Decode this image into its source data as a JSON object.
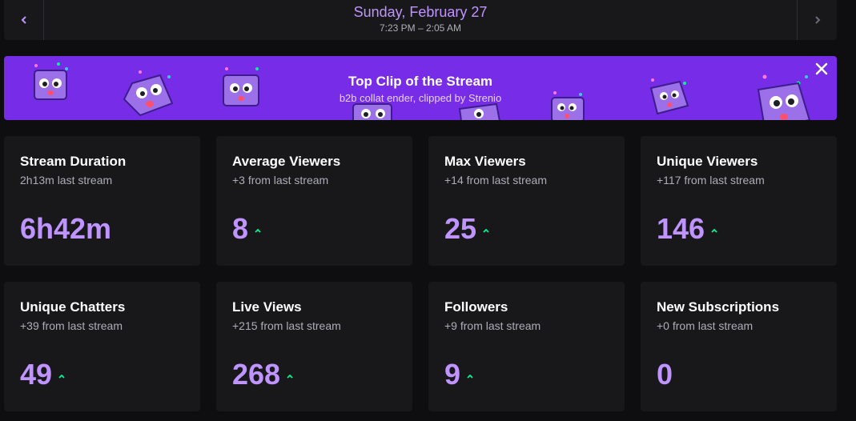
{
  "header": {
    "prev_icon": "chevron-left-icon",
    "next_icon": "chevron-right-icon",
    "date": "Sunday, February 27",
    "time_range": "7:23 PM – 2:05 AM"
  },
  "banner": {
    "title": "Top Clip of the Stream",
    "subtitle": "b2b collat ender, clipped by Strenio",
    "close_icon": "close-icon",
    "background": "#772ce8"
  },
  "colors": {
    "accent": "#bf94ff",
    "trend_up": "#00f593",
    "card_bg": "#18181b",
    "page_bg": "#0e0e10"
  },
  "stats": [
    {
      "title": "Stream Duration",
      "subtitle": "2h13m last stream",
      "value": "6h42m",
      "trend": "none"
    },
    {
      "title": "Average Viewers",
      "subtitle": "+3 from last stream",
      "value": "8",
      "trend": "up"
    },
    {
      "title": "Max Viewers",
      "subtitle": "+14 from last stream",
      "value": "25",
      "trend": "up"
    },
    {
      "title": "Unique Viewers",
      "subtitle": "+117 from last stream",
      "value": "146",
      "trend": "up"
    },
    {
      "title": "Unique Chatters",
      "subtitle": "+39 from last stream",
      "value": "49",
      "trend": "up"
    },
    {
      "title": "Live Views",
      "subtitle": "+215 from last stream",
      "value": "268",
      "trend": "up"
    },
    {
      "title": "Followers",
      "subtitle": "+9 from last stream",
      "value": "9",
      "trend": "up"
    },
    {
      "title": "New Subscriptions",
      "subtitle": "+0 from last stream",
      "value": "0",
      "trend": "none"
    }
  ]
}
